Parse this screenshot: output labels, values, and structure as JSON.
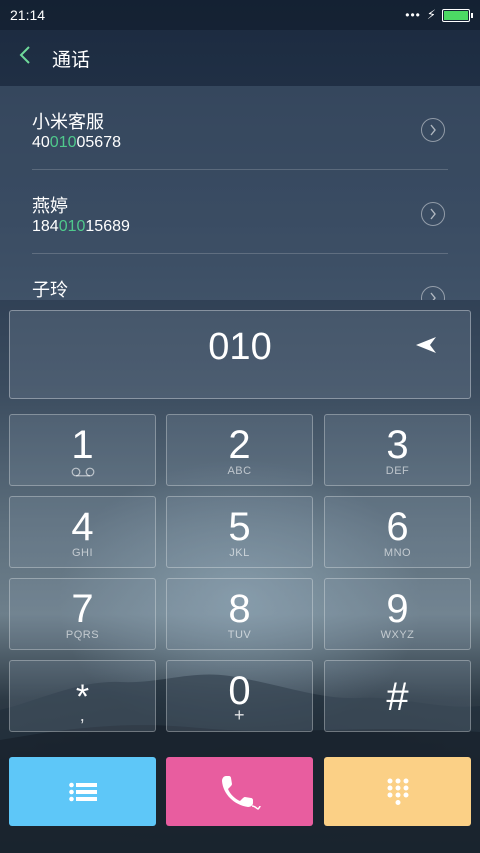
{
  "status_bar": {
    "time": "21:14",
    "dots": "•••",
    "charging": "⚡"
  },
  "header": {
    "title": "通话"
  },
  "results": [
    {
      "name": "小米客服",
      "number_pre": "40",
      "number_match": "010",
      "number_post": "05678"
    },
    {
      "name": "燕婷",
      "number_pre": "184",
      "number_match": "010",
      "number_post": "15689"
    },
    {
      "name": "子玲",
      "number_pre": "",
      "number_match": "",
      "number_post": ""
    }
  ],
  "dialer": {
    "entered_number": "010"
  },
  "keys": [
    {
      "digit": "1",
      "sub": ""
    },
    {
      "digit": "2",
      "sub": "ABC"
    },
    {
      "digit": "3",
      "sub": "DEF"
    },
    {
      "digit": "4",
      "sub": "GHI"
    },
    {
      "digit": "5",
      "sub": "JKL"
    },
    {
      "digit": "6",
      "sub": "MNO"
    },
    {
      "digit": "7",
      "sub": "PQRS"
    },
    {
      "digit": "8",
      "sub": "TUV"
    },
    {
      "digit": "9",
      "sub": "WXYZ"
    },
    {
      "digit": "*",
      "sub": ","
    },
    {
      "digit": "0",
      "sub": "+"
    },
    {
      "digit": "#",
      "sub": ""
    }
  ],
  "icons": {
    "back": "chevron-left-icon",
    "detail": "chevron-right-circle-icon",
    "delete": "backspace-icon",
    "voicemail": "voicemail-icon",
    "menu": "list-icon",
    "call": "phone-icon",
    "keypad": "keypad-icon"
  },
  "colors": {
    "highlight": "#4fc98c",
    "menu_button": "#5ec7f8",
    "call_button": "#e85d9f",
    "keypad_button": "#fbd086",
    "battery": "#4cd964"
  }
}
